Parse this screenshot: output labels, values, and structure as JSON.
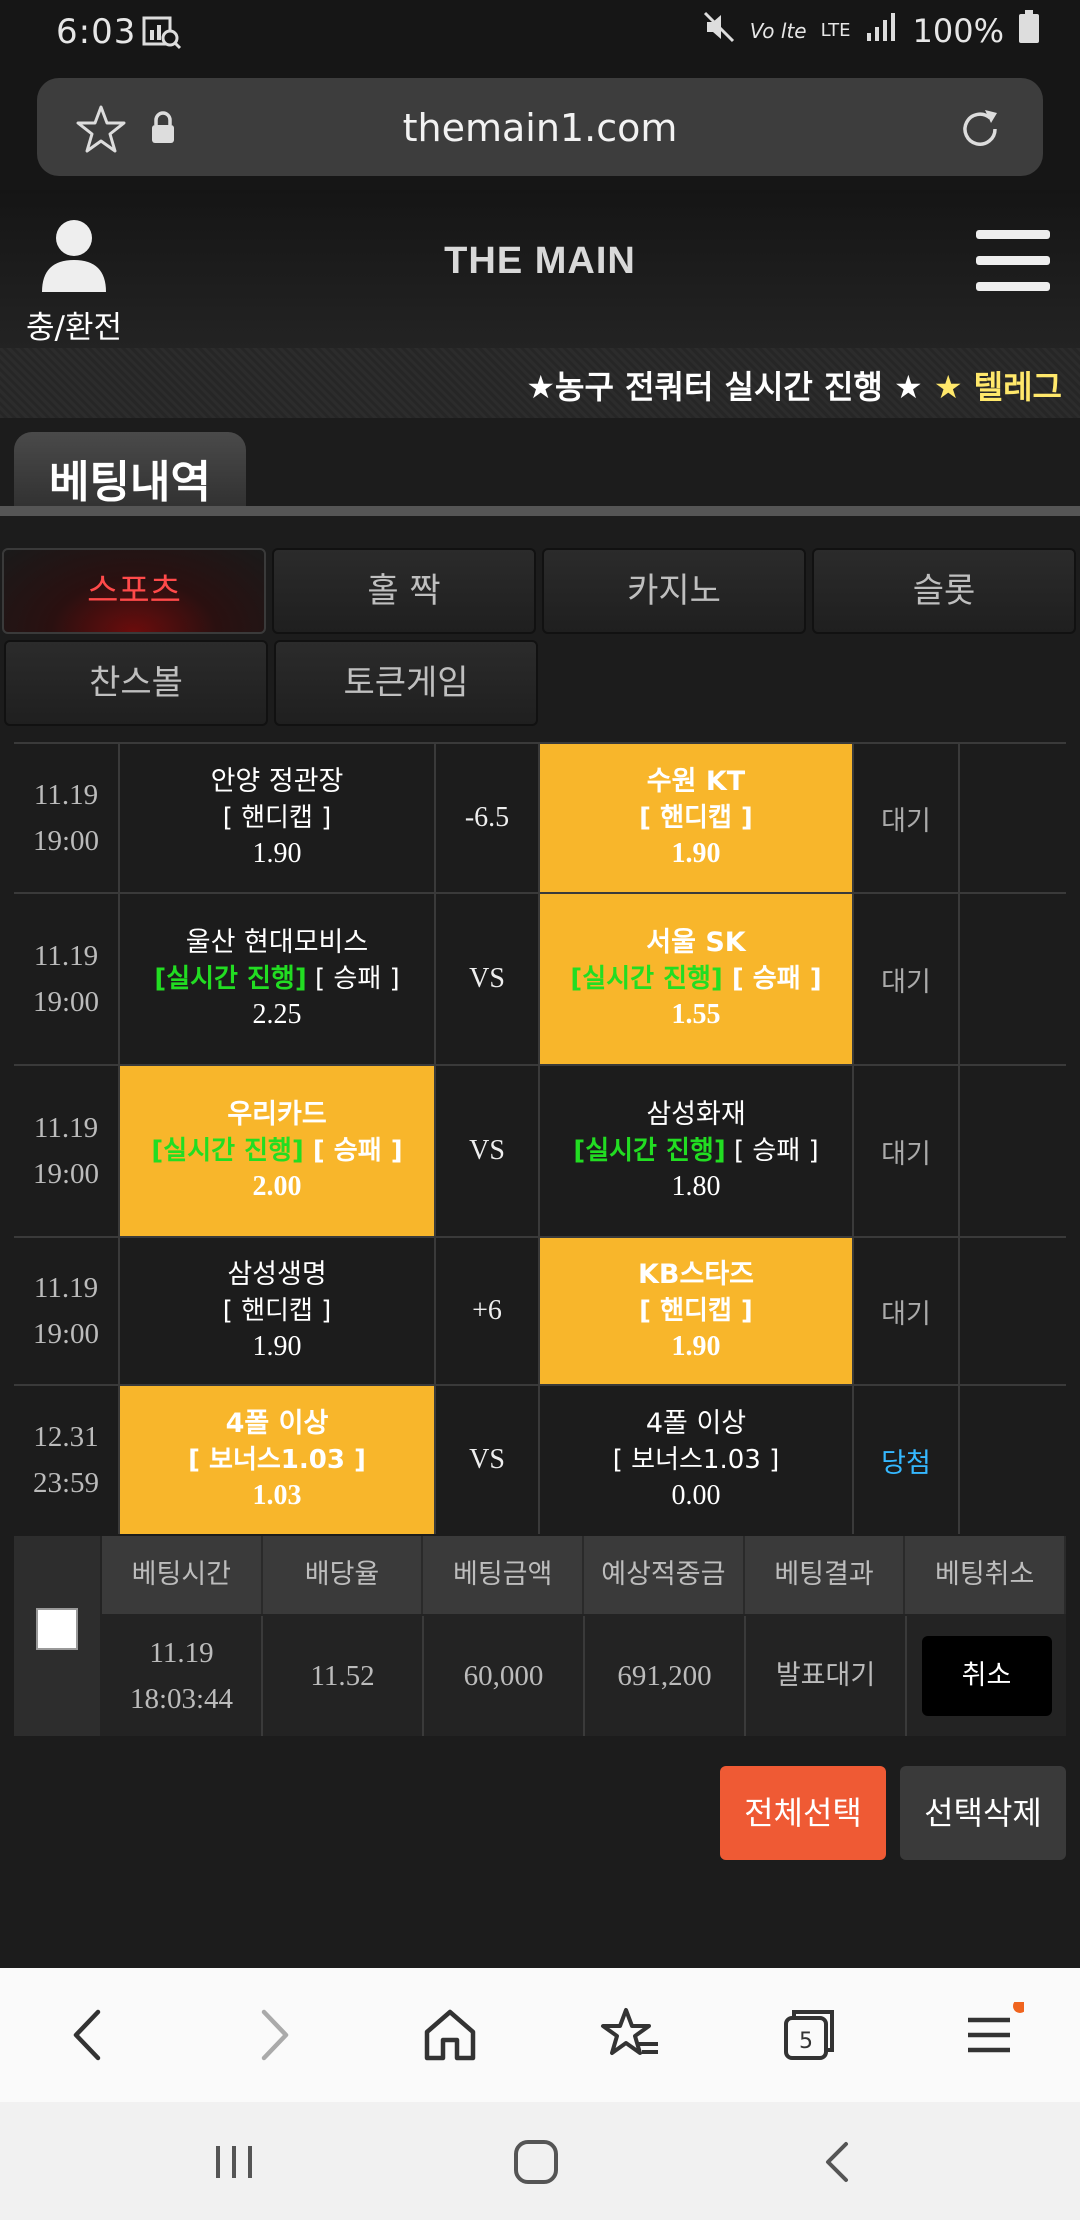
{
  "status_bar": {
    "time": "6:03",
    "battery": "100%",
    "network": "LTE"
  },
  "browser": {
    "url": "themain1.com"
  },
  "site": {
    "logo": "THE MAIN",
    "user_label": "충/환전"
  },
  "marquee": {
    "text_white": "★농구 전쿼터 실시간 진행 ★",
    "text_yellow": "★ 텔레그"
  },
  "section_title": "베팅내역",
  "tabs": [
    "스포츠",
    "홀 짝",
    "카지노",
    "슬롯",
    "찬스볼",
    "토큰게임"
  ],
  "bets": [
    {
      "date": "11.19",
      "time": "19:00",
      "home": {
        "team": "안양 정관장",
        "live": "",
        "market": "[ 핸디캡 ]",
        "odds": "1.90"
      },
      "mid": "-6.5",
      "away": {
        "team": "수원 KT",
        "live": "",
        "market": "[ 핸디캡 ]",
        "odds": "1.90"
      },
      "selected": "away",
      "status": "대기"
    },
    {
      "date": "11.19",
      "time": "19:00",
      "home": {
        "team": "울산 현대모비스",
        "live": "[실시간 진행]",
        "market": "[ 승패 ]",
        "odds": "2.25"
      },
      "mid": "VS",
      "away": {
        "team": "서울 SK",
        "live": "[실시간 진행]",
        "market": "[ 승패 ]",
        "odds": "1.55"
      },
      "selected": "away",
      "status": "대기"
    },
    {
      "date": "11.19",
      "time": "19:00",
      "home": {
        "team": "우리카드",
        "live": "[실시간 진행]",
        "market": "[ 승패 ]",
        "odds": "2.00"
      },
      "mid": "VS",
      "away": {
        "team": "삼성화재",
        "live": "[실시간 진행]",
        "market": "[ 승패 ]",
        "odds": "1.80"
      },
      "selected": "home",
      "status": "대기"
    },
    {
      "date": "11.19",
      "time": "19:00",
      "home": {
        "team": "삼성생명",
        "live": "",
        "market": "[ 핸디캡 ]",
        "odds": "1.90"
      },
      "mid": "+6",
      "away": {
        "team": "KB스타즈",
        "live": "",
        "market": "[ 핸디캡 ]",
        "odds": "1.90"
      },
      "selected": "away",
      "status": "대기"
    },
    {
      "date": "12.31",
      "time": "23:59",
      "home": {
        "team": "4폴 이상",
        "live": "",
        "market": "[ 보너스1.03 ]",
        "odds": "1.03"
      },
      "mid": "VS",
      "away": {
        "team": "4폴 이상",
        "live": "",
        "market": "[ 보너스1.03 ]",
        "odds": "0.00"
      },
      "selected": "home",
      "status": "당첨"
    }
  ],
  "summary": {
    "headers": [
      "베팅시간",
      "배당율",
      "베팅금액",
      "예상적중금",
      "베팅결과",
      "베팅취소"
    ],
    "bet_date": "11.19",
    "bet_time": "18:03:44",
    "odds": "11.52",
    "amount": "60,000",
    "expected": "691,200",
    "result": "발표대기",
    "cancel_label": "취소"
  },
  "buttons": {
    "select_all": "전체선택",
    "delete_selected": "선택삭제"
  },
  "browser_nav": {
    "tab_count": "5"
  },
  "colors": {
    "selected_bg": "#f8b62b",
    "live_text": "#22dd22",
    "win_text": "#35b8ff",
    "active_tab": "#ff4a4a",
    "select_all_bg": "#ef5a34"
  }
}
